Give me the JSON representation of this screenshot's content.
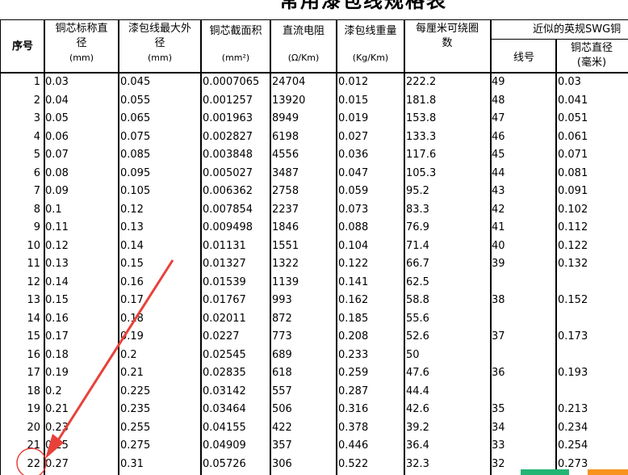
{
  "sheet": {
    "title": "常用漆包线规格表",
    "headers": {
      "seq": "序号",
      "copper_dia_line1": "铜芯标称直",
      "copper_dia_line2": "径",
      "copper_dia_unit": "(mm)",
      "enamel_dia_line1": "漆包线最大外",
      "enamel_dia_line2": "径",
      "enamel_dia_unit": "(mm)",
      "area": "铜芯截面积",
      "area_unit": "(mm²)",
      "resistance": "直流电阻",
      "resistance_unit": "(Ω/Km)",
      "weight": "漆包线重量",
      "weight_unit": "(Kg/Km)",
      "turns_line1": "每厘米可绕圈",
      "turns_line2": "数",
      "swg_group": "近似的英规SWG铜",
      "swg_no": "线号",
      "swg_dia_line1": "铜芯直径",
      "swg_dia_line2": "(毫米)"
    },
    "rows": [
      [
        "1",
        "0.03",
        "0.045",
        "0.0007065",
        "24704",
        "0.012",
        "222.2",
        "49",
        "0.03"
      ],
      [
        "2",
        "0.04",
        "0.055",
        "0.001257",
        "13920",
        "0.015",
        "181.8",
        "48",
        "0.041"
      ],
      [
        "3",
        "0.05",
        "0.065",
        "0.001963",
        "8949",
        "0.019",
        "153.8",
        "47",
        "0.051"
      ],
      [
        "4",
        "0.06",
        "0.075",
        "0.002827",
        "6198",
        "0.027",
        "133.3",
        "46",
        "0.061"
      ],
      [
        "5",
        "0.07",
        "0.085",
        "0.003848",
        "4556",
        "0.036",
        "117.6",
        "45",
        "0.071"
      ],
      [
        "6",
        "0.08",
        "0.095",
        "0.005027",
        "3487",
        "0.047",
        "105.3",
        "44",
        "0.081"
      ],
      [
        "7",
        "0.09",
        "0.105",
        "0.006362",
        "2758",
        "0.059",
        "95.2",
        "43",
        "0.091"
      ],
      [
        "8",
        "0.1",
        "0.12",
        "0.007854",
        "2237",
        "0.073",
        "83.3",
        "42",
        "0.102"
      ],
      [
        "9",
        "0.11",
        "0.13",
        "0.009498",
        "1846",
        "0.088",
        "76.9",
        "41",
        "0.112"
      ],
      [
        "10",
        "0.12",
        "0.14",
        "0.01131",
        "1551",
        "0.104",
        "71.4",
        "40",
        "0.122"
      ],
      [
        "11",
        "0.13",
        "0.15",
        "0.01327",
        "1322",
        "0.122",
        "66.7",
        "39",
        "0.132"
      ],
      [
        "12",
        "0.14",
        "0.16",
        "0.01539",
        "1139",
        "0.141",
        "62.5",
        "",
        ""
      ],
      [
        "13",
        "0.15",
        "0.17",
        "0.01767",
        "993",
        "0.162",
        "58.8",
        "38",
        "0.152"
      ],
      [
        "14",
        "0.16",
        "0.18",
        "0.02011",
        "872",
        "0.185",
        "55.6",
        "",
        ""
      ],
      [
        "15",
        "0.17",
        "0.19",
        "0.0227",
        "773",
        "0.208",
        "52.6",
        "37",
        "0.173"
      ],
      [
        "16",
        "0.18",
        "0.2",
        "0.02545",
        "689",
        "0.233",
        "50",
        "",
        ""
      ],
      [
        "17",
        "0.19",
        "0.21",
        "0.02835",
        "618",
        "0.259",
        "47.6",
        "36",
        "0.193"
      ],
      [
        "18",
        "0.2",
        "0.225",
        "0.03142",
        "557",
        "0.287",
        "44.4",
        "",
        ""
      ],
      [
        "19",
        "0.21",
        "0.235",
        "0.03464",
        "506",
        "0.316",
        "42.6",
        "35",
        "0.213"
      ],
      [
        "20",
        "0.23",
        "0.255",
        "0.04155",
        "422",
        "0.378",
        "39.2",
        "34",
        "0.234"
      ],
      [
        "21",
        "0.25",
        "0.275",
        "0.04909",
        "357",
        "0.446",
        "36.4",
        "33",
        "0.254"
      ],
      [
        "22",
        "0.27",
        "0.31",
        "0.05726",
        "306",
        "0.522",
        "32.3",
        "32",
        "0.273"
      ]
    ]
  },
  "annotation": {
    "arrow_color": "#e8413a",
    "circle_color": "#e8413a"
  }
}
